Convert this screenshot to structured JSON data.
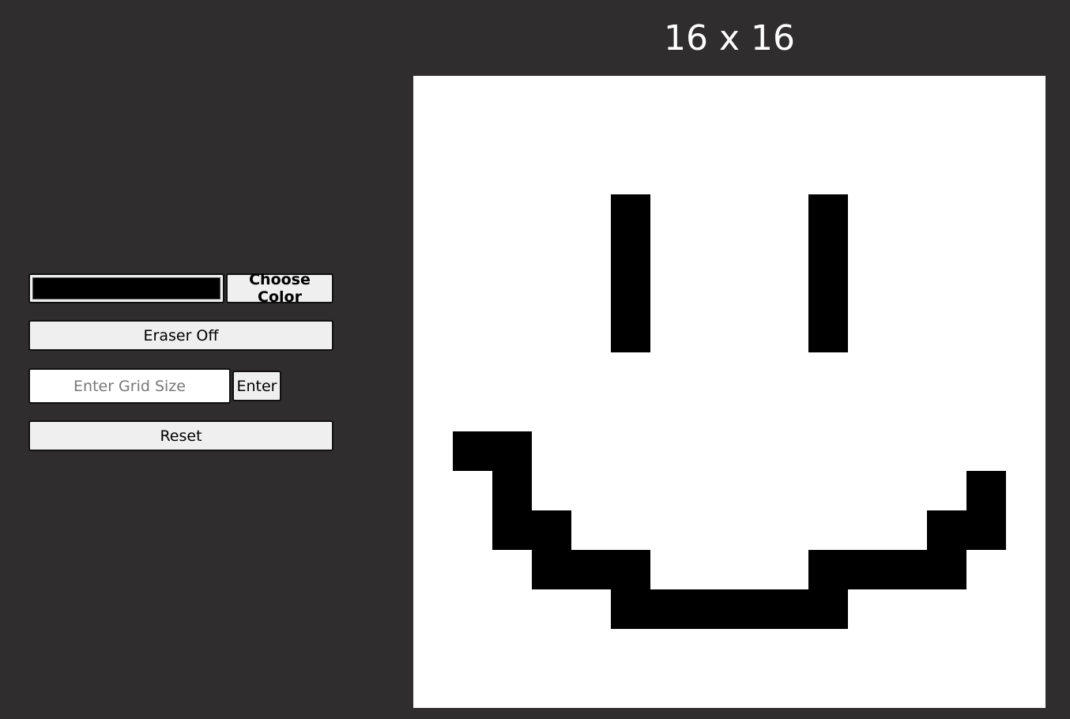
{
  "header": {
    "title": "16 x 16"
  },
  "controls": {
    "current_color": "#000000",
    "choose_color_label": "Choose Color",
    "eraser_label": "Eraser Off",
    "grid_size_placeholder": "Enter Grid Size",
    "grid_size_value": "",
    "enter_label": "Enter",
    "reset_label": "Reset"
  },
  "canvas": {
    "rows": 16,
    "cols": 16,
    "background_color": "#ffffff",
    "paint_color": "#000000",
    "filled_cells": [
      [
        3,
        5
      ],
      [
        3,
        10
      ],
      [
        4,
        5
      ],
      [
        4,
        10
      ],
      [
        5,
        5
      ],
      [
        5,
        10
      ],
      [
        6,
        5
      ],
      [
        6,
        10
      ],
      [
        9,
        1
      ],
      [
        9,
        2
      ],
      [
        10,
        2
      ],
      [
        10,
        14
      ],
      [
        11,
        2
      ],
      [
        11,
        3
      ],
      [
        11,
        13
      ],
      [
        11,
        14
      ],
      [
        12,
        3
      ],
      [
        12,
        4
      ],
      [
        12,
        5
      ],
      [
        12,
        10
      ],
      [
        12,
        11
      ],
      [
        12,
        12
      ],
      [
        12,
        13
      ],
      [
        13,
        5
      ],
      [
        13,
        6
      ],
      [
        13,
        7
      ],
      [
        13,
        8
      ],
      [
        13,
        9
      ],
      [
        13,
        10
      ]
    ]
  }
}
